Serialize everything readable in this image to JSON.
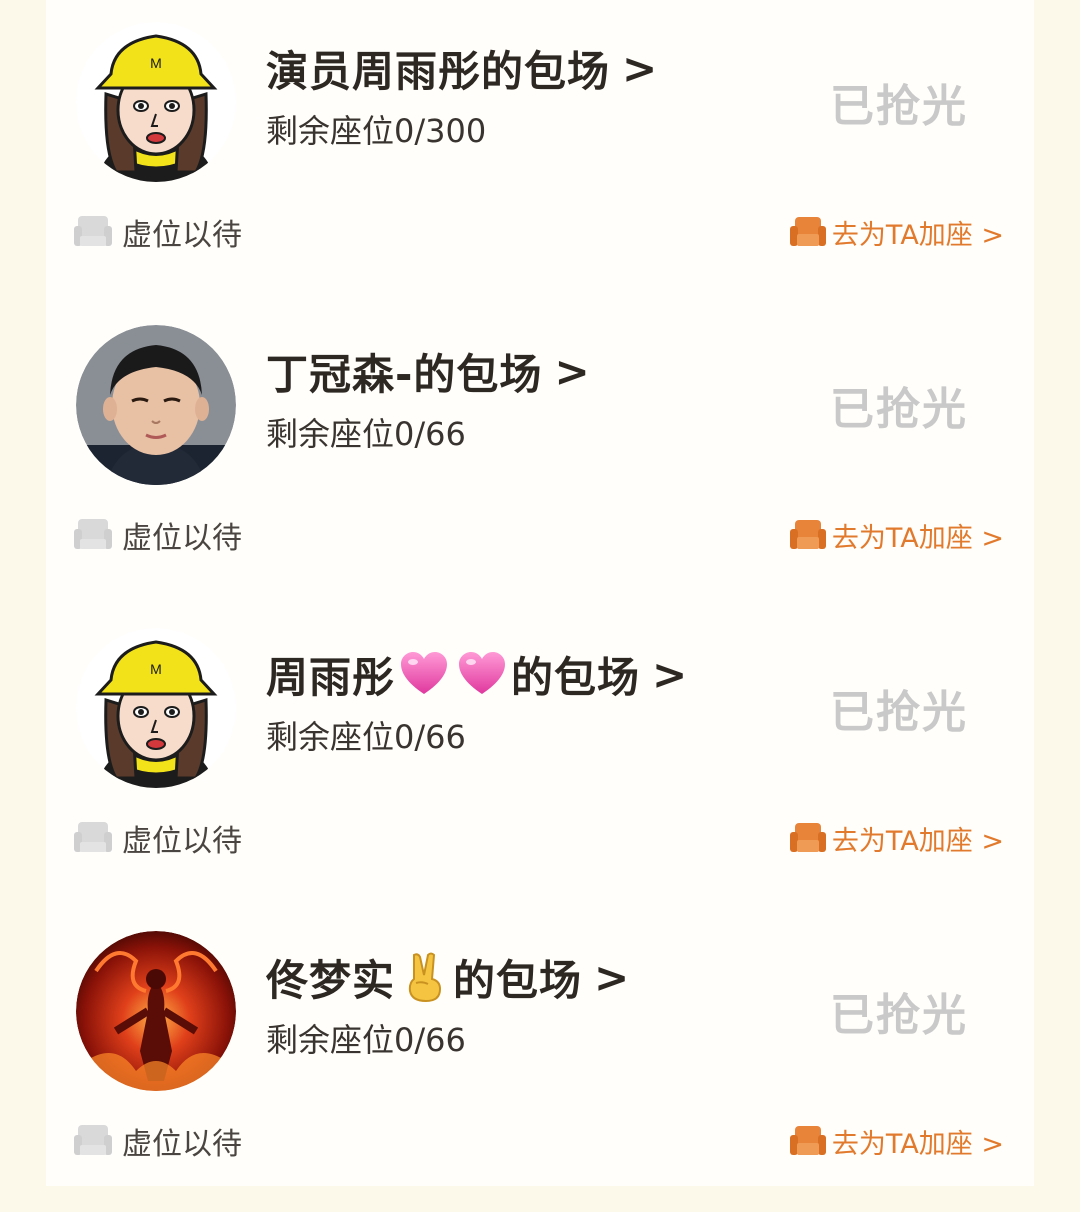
{
  "cards": [
    {
      "name": "演员周雨彤的包场",
      "name_parts": [
        "演员周雨彤的包场"
      ],
      "chevron": ">",
      "seats": "剩余座位0/300",
      "status": "已抢光",
      "waiting": "虚位以待",
      "add_seat": "去为TA加座 >",
      "avatar": "cartoon-girl-yellow-hat"
    },
    {
      "name": "丁冠森-的包场",
      "name_parts": [
        "丁冠森-的包场"
      ],
      "chevron": ">",
      "seats": "剩余座位0/66",
      "status": "已抢光",
      "waiting": "虚位以待",
      "add_seat": "去为TA加座 >",
      "avatar": "child-photo"
    },
    {
      "name": "周雨彤💗💗的包场",
      "name_parts": [
        "周雨彤",
        "的包场"
      ],
      "chevron": ">",
      "seats": "剩余座位0/66",
      "status": "已抢光",
      "waiting": "虚位以待",
      "add_seat": "去为TA加座 >",
      "avatar": "cartoon-girl-yellow-hat"
    },
    {
      "name": "佟梦实✌️的包场",
      "name_parts": [
        "佟梦实",
        "的包场"
      ],
      "chevron": ">",
      "seats": "剩余座位0/66",
      "status": "已抢光",
      "waiting": "虚位以待",
      "add_seat": "去为TA加座 >",
      "avatar": "fire-demon-art"
    }
  ],
  "colors": {
    "page_background": "#fdf9ea",
    "card_background": "#fffefa",
    "title": "#2e2823",
    "sold_out": "#c9c9c9",
    "accent_orange": "#e27a2d",
    "waiting_icon": "#d6d6d6"
  }
}
